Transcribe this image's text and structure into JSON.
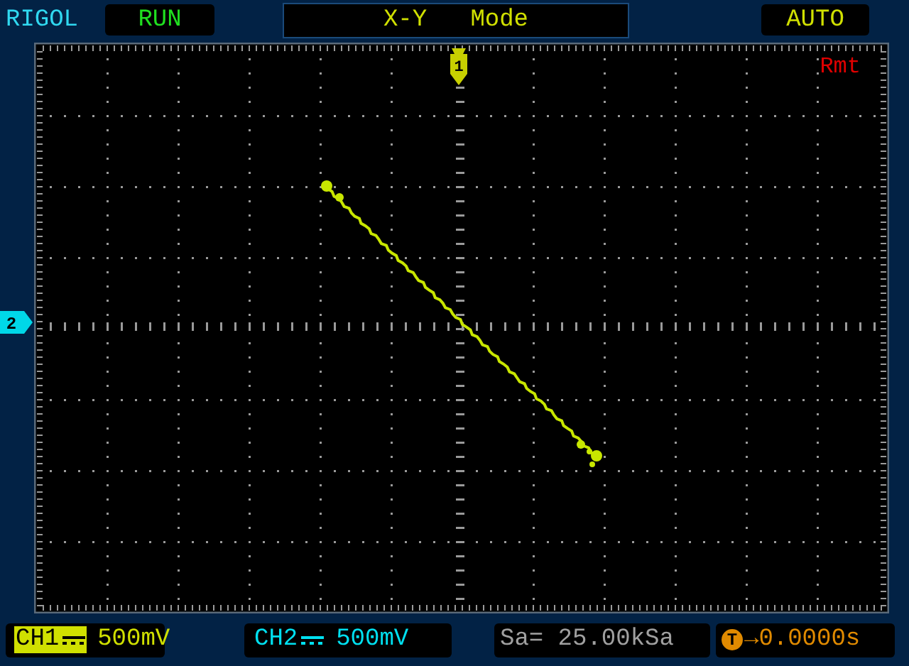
{
  "brand": "RIGOL",
  "run_status": "RUN",
  "mode": "X-Y   Mode",
  "trigger_mode": "AUTO",
  "screen": {
    "ch1_marker": "1",
    "ch2_marker": "2",
    "remote": "Rmt"
  },
  "channels": [
    {
      "label": "CH1",
      "scale": "500mV",
      "selected": true,
      "color": "#d0e000"
    },
    {
      "label": "CH2",
      "scale": "500mV",
      "selected": false,
      "color": "#00e0f0"
    }
  ],
  "sample_rate": "Sa= 25.00kSa",
  "trigger": {
    "badge": "T",
    "offset": "→0.0000s"
  }
}
